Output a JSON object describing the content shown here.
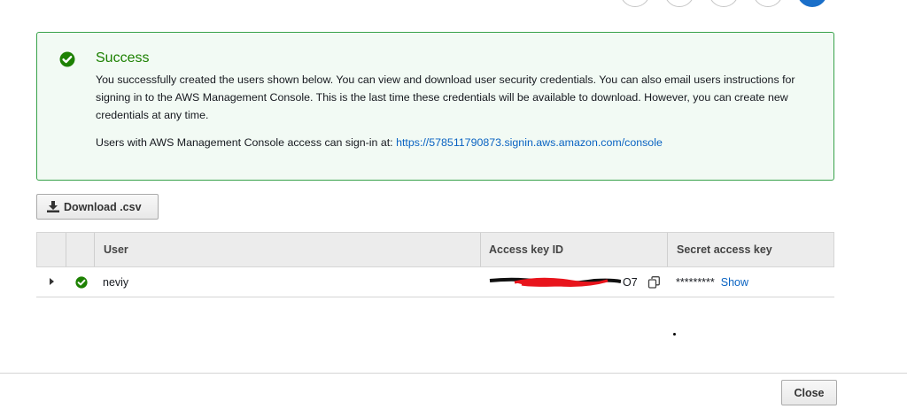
{
  "alert": {
    "title": "Success",
    "message": "You successfully created the users shown below. You can view and download user security credentials. You can also email users instructions for signing in to the AWS Management Console. This is the last time these credentials will be available to download. However, you can create new credentials at any time.",
    "signin_prefix": "Users with AWS Management Console access can sign-in at: ",
    "signin_url": "https://578511790873.signin.aws.amazon.com/console"
  },
  "toolbar": {
    "download_label": "Download .csv"
  },
  "table": {
    "columns": [
      "User",
      "Access key ID",
      "Secret access key"
    ],
    "rows": [
      {
        "user": "neviy",
        "access_key_suffix": "O7",
        "secret_masked": "*********",
        "show_label": "Show"
      }
    ]
  },
  "footer": {
    "close_label": "Close"
  },
  "colors": {
    "success": "#1d8102",
    "link": "#0a63c2",
    "step_active": "#1a6fc9",
    "redaction": "#e8141c"
  }
}
